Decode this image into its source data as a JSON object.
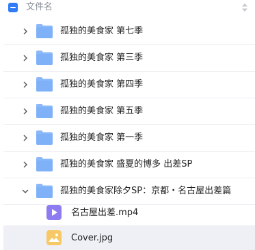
{
  "header": {
    "column_label": "文件名",
    "check_state": "indeterminate"
  },
  "rows": [
    {
      "name": "孤独的美食家 第七季",
      "type": "folder",
      "expanded": false
    },
    {
      "name": "孤独的美食家 第三季",
      "type": "folder",
      "expanded": false
    },
    {
      "name": "孤独的美食家 第四季",
      "type": "folder",
      "expanded": false
    },
    {
      "name": "孤独的美食家 第五季",
      "type": "folder",
      "expanded": false
    },
    {
      "name": "孤独的美食家 第一季",
      "type": "folder",
      "expanded": false
    },
    {
      "name": "孤独的美食家 盛夏的博多 出差SP",
      "type": "folder",
      "expanded": false
    },
    {
      "name": "孤独的美食家除夕SP：京都・名古屋出差篇",
      "type": "folder",
      "expanded": true
    },
    {
      "name": "名古屋出差.mp4",
      "type": "video",
      "child": true
    },
    {
      "name": "Cover.jpg",
      "type": "image",
      "child": true
    }
  ],
  "colors": {
    "accent": "#2f7cf6",
    "folder": "#7fb1f8",
    "video": "#8c7cf0",
    "image": "#f7c866"
  }
}
